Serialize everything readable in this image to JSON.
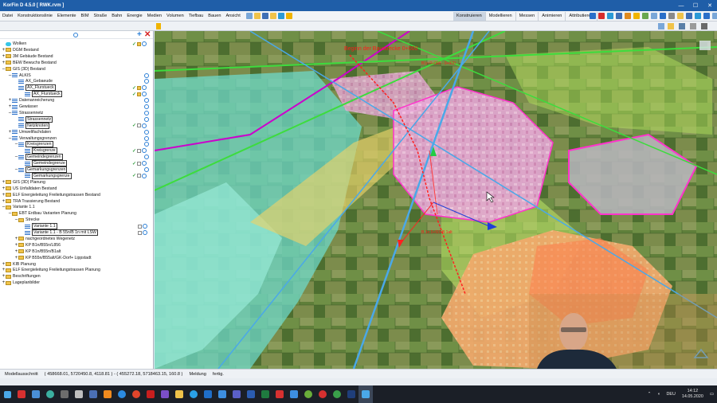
{
  "app": {
    "title": "KorFin D 4.5.0 [ RWK.rvm ]",
    "window_controls": [
      "—",
      "☐",
      "✕"
    ]
  },
  "menu": {
    "items": [
      "Datei",
      "Konstruktionslinie",
      "Elemente",
      "BIM",
      "Straße",
      "Bahn",
      "Energie",
      "Medien",
      "Volumen",
      "Tiefbau",
      "Bauen",
      "Ansicht"
    ],
    "right_tabs": [
      "Konstruieren",
      "Modellieren",
      "Messen",
      "Animieren",
      "Attributieren"
    ]
  },
  "tree": {
    "rows": [
      {
        "label": "Wolken",
        "level": 0,
        "icon": "cloud",
        "expand": "",
        "actions": "check-pair"
      },
      {
        "label": "DGM Bestand",
        "level": 0,
        "icon": "folder",
        "expand": "+",
        "actions": ""
      },
      {
        "label": "3M Gebäude Bestand",
        "level": 0,
        "icon": "folder",
        "expand": "+",
        "actions": ""
      },
      {
        "label": "BEW Bewuchs Bestand",
        "level": 0,
        "icon": "folder",
        "expand": "+",
        "actions": ""
      },
      {
        "label": "GIS (3D) Bestand",
        "level": 0,
        "icon": "folder",
        "expand": "–",
        "actions": ""
      },
      {
        "label": "ALKIS",
        "level": 1,
        "icon": "layer",
        "expand": "–",
        "actions": "search"
      },
      {
        "label": "AX_Gebaeude",
        "level": 2,
        "icon": "layer",
        "expand": "",
        "actions": "search"
      },
      {
        "label": "AX_Flurstueck",
        "level": 2,
        "icon": "layer",
        "expand": "",
        "actions": "check-full",
        "boxed": true
      },
      {
        "label": "AX_Flurstueck",
        "level": 3,
        "icon": "layer",
        "expand": "",
        "actions": "check-full",
        "boxed": true
      },
      {
        "label": "Datenanreicherung",
        "level": 1,
        "icon": "layer",
        "expand": "+",
        "actions": "search"
      },
      {
        "label": "Gewässer",
        "level": 1,
        "icon": "layer",
        "expand": "+",
        "actions": "search"
      },
      {
        "label": "Strassennetz",
        "level": 1,
        "icon": "layer",
        "expand": "–",
        "actions": "search"
      },
      {
        "label": "Strassennetz",
        "level": 2,
        "icon": "layer",
        "expand": "",
        "actions": "search",
        "boxed": true
      },
      {
        "label": "Netzknoten",
        "level": 2,
        "icon": "layer",
        "expand": "",
        "actions": "check-box",
        "boxed": true
      },
      {
        "label": "Umweltfachdaten",
        "level": 1,
        "icon": "layer",
        "expand": "+",
        "actions": "search"
      },
      {
        "label": "Verwaltungsgrenzen",
        "level": 1,
        "icon": "layer",
        "expand": "–",
        "actions": "search"
      },
      {
        "label": "Kreisgrenzen",
        "level": 2,
        "icon": "layer",
        "expand": "–",
        "actions": "search",
        "boxed": true
      },
      {
        "label": "Kreisgrenze",
        "level": 3,
        "icon": "layer",
        "expand": "",
        "actions": "check-box",
        "boxed": true
      },
      {
        "label": "Gemeindegrenzen",
        "level": 2,
        "icon": "layer",
        "expand": "–",
        "actions": "search",
        "boxed": true
      },
      {
        "label": "Gemeindegrenze",
        "level": 3,
        "icon": "layer",
        "expand": "",
        "actions": "check-box",
        "boxed": true
      },
      {
        "label": "Gemarkungsgrenzen",
        "level": 2,
        "icon": "layer",
        "expand": "–",
        "actions": "search",
        "boxed": true
      },
      {
        "label": "Gemarkungsgrenze",
        "level": 3,
        "icon": "layer",
        "expand": "",
        "actions": "check-box",
        "boxed": true
      },
      {
        "label": "GIS (3D) Planung",
        "level": 0,
        "icon": "folder",
        "expand": "+",
        "actions": ""
      },
      {
        "label": "US Unfalldaten Bestand",
        "level": 0,
        "icon": "folder",
        "expand": "+",
        "actions": ""
      },
      {
        "label": "ELF Energieleitung Freileitungstrassen Bestand",
        "level": 0,
        "icon": "folder",
        "expand": "+",
        "actions": ""
      },
      {
        "label": "TRA Trassierung Bestand",
        "level": 0,
        "icon": "folder",
        "expand": "+",
        "actions": ""
      },
      {
        "label": "Variante 1.1",
        "level": 0,
        "icon": "folder",
        "expand": "–",
        "actions": ""
      },
      {
        "label": "EBT Erdbau Varianten Planung",
        "level": 1,
        "icon": "folder",
        "expand": "–",
        "actions": ""
      },
      {
        "label": "Strecke",
        "level": 2,
        "icon": "folder",
        "expand": "–",
        "actions": ""
      },
      {
        "label": "Variante 1.1",
        "level": 3,
        "icon": "layer",
        "expand": "",
        "actions": "box-search",
        "boxed": true
      },
      {
        "label": "Variante 1.1 - B 55n/B 1n mit LSW",
        "level": 3,
        "icon": "layer",
        "expand": "",
        "actions": "box-search",
        "boxed": true
      },
      {
        "label": "nachgeordnetes Wegenetz",
        "level": 2,
        "icon": "folder",
        "expand": "+",
        "actions": ""
      },
      {
        "label": "KP B1n/B55n/L856",
        "level": 2,
        "icon": "folder",
        "expand": "+",
        "actions": ""
      },
      {
        "label": "KP B1n/B55n/B1alt",
        "level": 2,
        "icon": "folder",
        "expand": "+",
        "actions": ""
      },
      {
        "label": "KP B55n/B55alt/GK-Dorf+ Lippstadt",
        "level": 2,
        "icon": "folder",
        "expand": "+",
        "actions": ""
      },
      {
        "label": "KIB Planung",
        "level": 0,
        "icon": "folder",
        "expand": "+",
        "actions": ""
      },
      {
        "label": "ELF Energieleitung Freileitungstrassen Planung",
        "level": 0,
        "icon": "folder",
        "expand": "+",
        "actions": ""
      },
      {
        "label": "Beschriftungen",
        "level": 0,
        "icon": "folder",
        "expand": "+",
        "actions": ""
      },
      {
        "label": "Lageplanbilder",
        "level": 0,
        "icon": "folder",
        "expand": "+",
        "actions": ""
      }
    ]
  },
  "map": {
    "label_start": "Beginn der Baustrecke 0+000",
    "label_station_1": "B1n 0+000 - 0+000",
    "label_station_2": "B 1n 0+50=B 1alt"
  },
  "status": {
    "model_area_label": "Modellausschnitt",
    "model_area_value": "( 458668.01, 5720450.8, 4118.81 ) - ( 455272.18, 5718463.15, 160.8 )",
    "message_label": "Meldung",
    "message_value": "fertig."
  },
  "taskbar": {
    "language": "DEU",
    "time": "14:12",
    "date": "14.05.2020"
  },
  "colors": {
    "titlebar": "#1f5ea8",
    "folder": "#f0c34a",
    "check": "#2e9b3a",
    "route": "#ff2020",
    "boundary": "#ff33cc",
    "road": "#4aa8e8"
  }
}
